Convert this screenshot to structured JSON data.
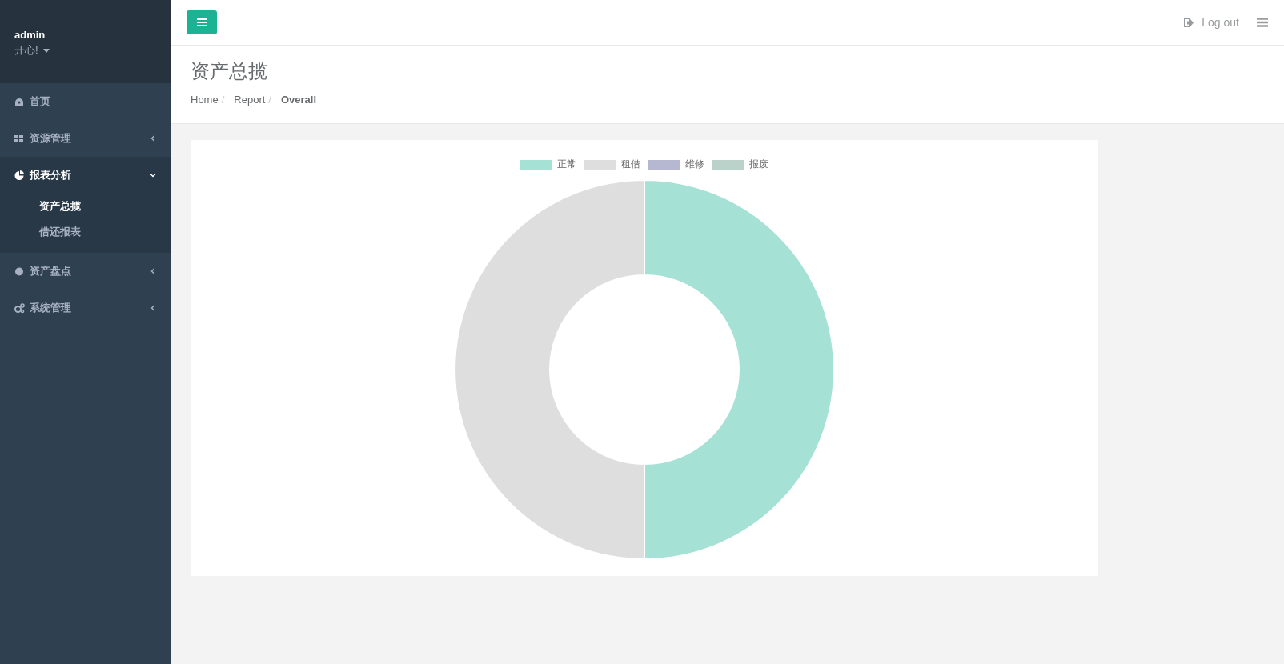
{
  "sidebar": {
    "user": {
      "name": "admin",
      "status": "开心!"
    },
    "items": [
      {
        "label": "首页",
        "expanded": false
      },
      {
        "label": "资源管理",
        "expanded": false
      },
      {
        "label": "报表分析",
        "expanded": true,
        "children": [
          {
            "label": "资产总揽",
            "selected": true
          },
          {
            "label": "借还报表",
            "selected": false
          }
        ]
      },
      {
        "label": "资产盘点",
        "expanded": false
      },
      {
        "label": "系统管理",
        "expanded": false
      }
    ]
  },
  "topbar": {
    "logout": "Log out"
  },
  "page": {
    "title": "资产总揽",
    "breadcrumb": [
      {
        "label": "Home",
        "separator": "/"
      },
      {
        "label": "Report",
        "separator": "/"
      },
      {
        "label": "Overall"
      }
    ]
  },
  "chart_data": {
    "type": "donut",
    "legend": "top",
    "categories": [
      "正常",
      "租借",
      "维修",
      "报废"
    ],
    "values": [
      50,
      50,
      0,
      0
    ],
    "colors": [
      "#a5e1d5",
      "#dedede",
      "#b6b7d0",
      "#bad2ca"
    ]
  }
}
